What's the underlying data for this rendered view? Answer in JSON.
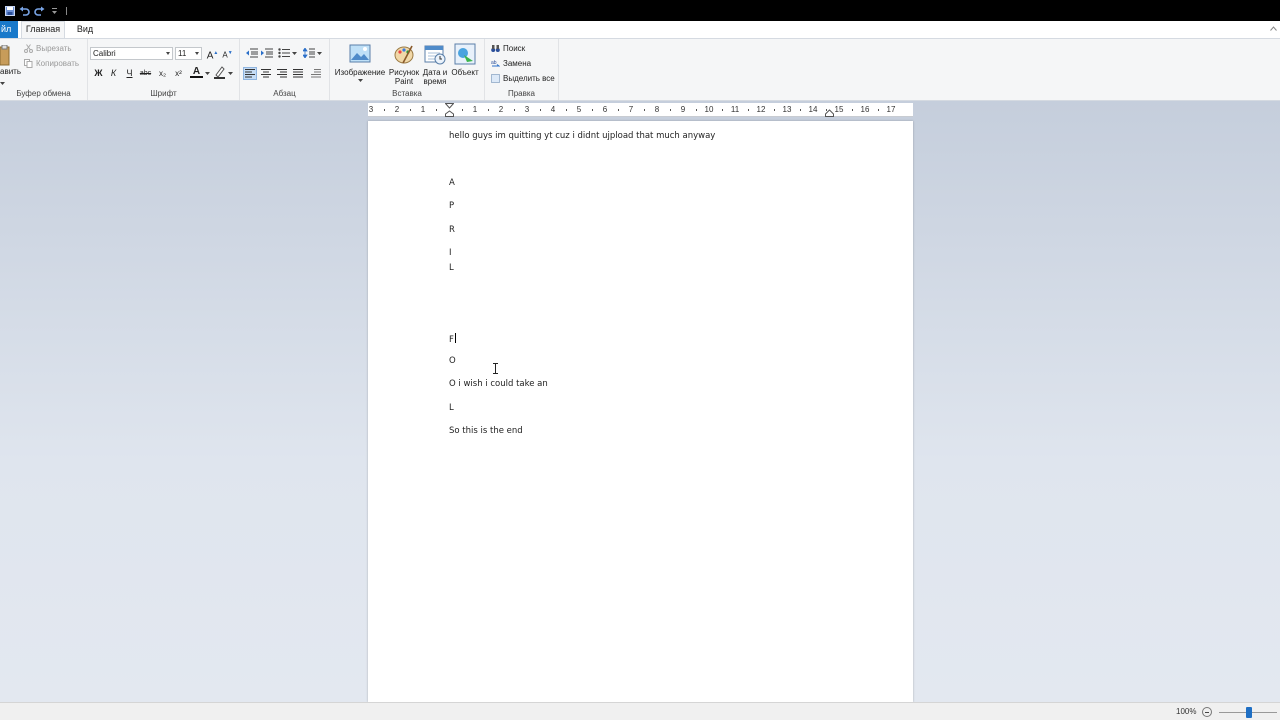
{
  "app": "Paint/WordPad style editor",
  "quick_access": {
    "icons": [
      "save-icon",
      "undo-icon",
      "redo-icon",
      "customize-dropdown-icon"
    ]
  },
  "tabs": {
    "file": "йл",
    "home": "Главная",
    "view": "Вид"
  },
  "ribbon": {
    "clipboard": {
      "label": "Буфер обмена",
      "paste_label": "авить",
      "cut_label": "Вырезать",
      "copy_label": "Копировать"
    },
    "font": {
      "label": "Шрифт",
      "family": "Calibri",
      "size": "11",
      "bold": "Ж",
      "italic": "К",
      "underline": "Ч",
      "strike": "abc",
      "subscript": "x₂",
      "superscript": "x²",
      "grow": "A",
      "shrink": "A",
      "font_color": "A"
    },
    "paragraph": {
      "label": "Абзац"
    },
    "insert": {
      "label": "Вставка",
      "image_label": "Изображение",
      "paint_label_1": "Рисунок",
      "paint_label_2": "Paint",
      "datetime_label_1": "Дата и",
      "datetime_label_2": "время",
      "object_label": "Объект"
    },
    "editing": {
      "label": "Правка",
      "find_label": "Поиск",
      "replace_label": "Замена",
      "select_all_label": "Выделить все"
    }
  },
  "ruler": {
    "labels": [
      "3",
      "2",
      "1",
      "1",
      "2",
      "3",
      "4",
      "5",
      "6",
      "7",
      "8",
      "9",
      "10",
      "11",
      "12",
      "13",
      "14",
      "15",
      "16",
      "17"
    ]
  },
  "document": {
    "lines": [
      "hello guys im quitting yt cuz i didnt ujpload that much anyway",
      "A",
      "P",
      "R",
      "I",
      "L",
      "F",
      "O",
      "O i wish i could take an",
      "L",
      "So this is the end"
    ]
  },
  "status": {
    "zoom": "100%",
    "zoom_level_percent": 100
  },
  "colors": {
    "accent": "#1979ca",
    "ribbon_bg": "#f5f6f7",
    "workspace": "#d5dce8"
  }
}
